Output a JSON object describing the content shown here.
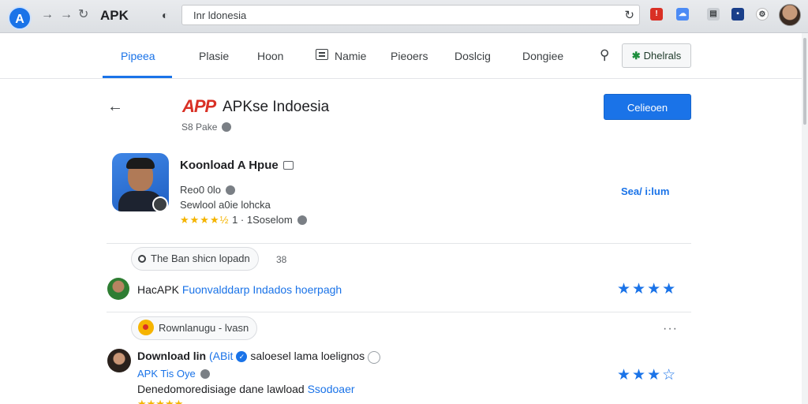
{
  "browser": {
    "logo": "A",
    "brand": "APK",
    "url": "Inr ldonesia"
  },
  "nav": {
    "tabs": [
      "Pipeea",
      "Plasie",
      "Hoon",
      "Namie",
      "Pieoers",
      "Doslcig",
      "Dongiee"
    ],
    "active_tab": "Pipeea",
    "details_label": "Dhelrals"
  },
  "header": {
    "logo_text": "APP",
    "title": "APKse Indoesia",
    "subtitle": "S8 Pake",
    "primary_button": "Celieoen"
  },
  "app": {
    "name": "Koonload A Hpue",
    "meta": "Reo0 0lo",
    "description": "Sewlool a0ie lohcka",
    "rating_stars": "★★★★",
    "rating_half": "½",
    "rating_text": "1 · 1Soselom",
    "see_link": "Sea/ i:lum",
    "rating": 4.5
  },
  "reviews": {
    "chip1": "The Ban shicn lopadn",
    "chip1_count": "38",
    "review1": {
      "prefix": "HacAPK",
      "body": "Fuonvalddarp Indados hoerpagh",
      "stars": "★★★★"
    },
    "chip2": "Rownlanugu - lvasn",
    "more": "···",
    "review2": {
      "title": "Download lin",
      "title_link": "(ABit",
      "verified": "✓",
      "text": "saloesel lama loelignos",
      "meta": "APK Tis Oye",
      "body": "Denedomoredisiage dane lawload",
      "body_link": "Ssodoaer",
      "stars": "★★★",
      "half_star": "☆"
    },
    "bottom_stars": "★★★★★"
  },
  "colors": {
    "accent": "#1a73e8",
    "logo_red": "#d93025",
    "star_gold": "#f4b400"
  }
}
